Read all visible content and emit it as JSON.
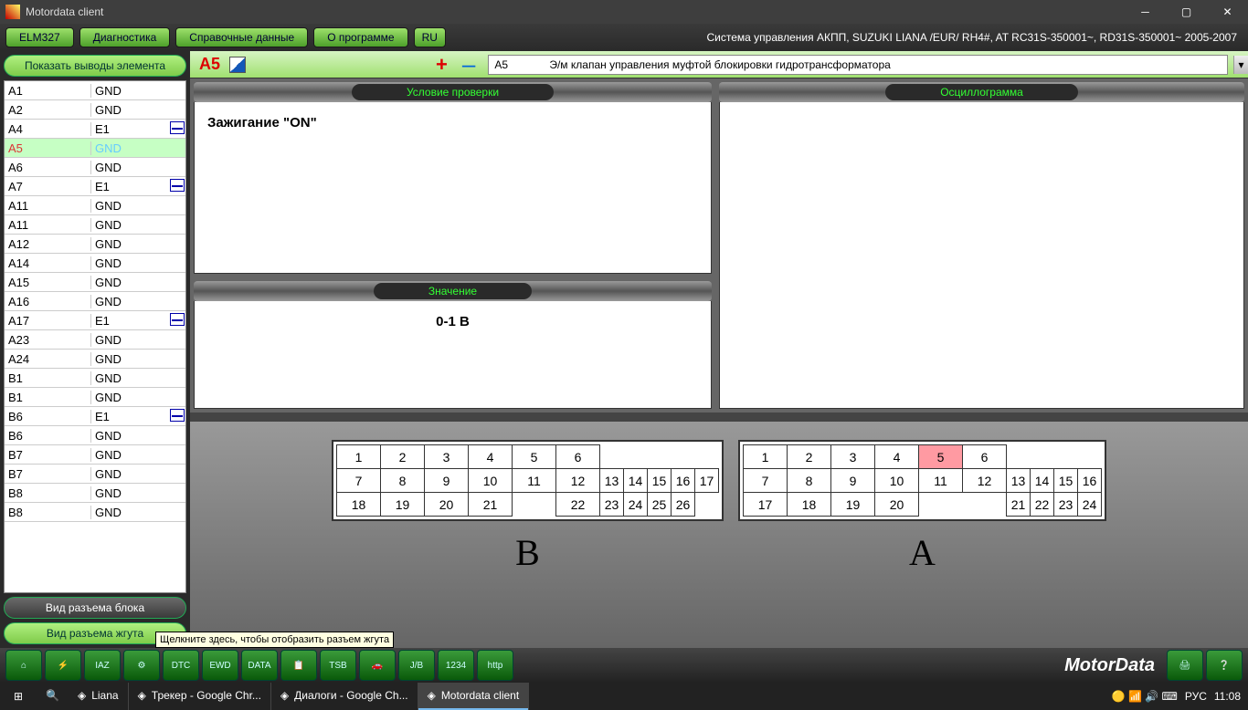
{
  "window": {
    "title": "Motordata client"
  },
  "topbar": {
    "btn1": "ELM327",
    "btn2": "Диагностика",
    "btn3": "Справочные данные",
    "btn4": "О программе",
    "lang": "RU",
    "info": "Система управления АКПП, SUZUKI  LIANA /EUR/  RH4#,   AT  RC31S-350001~, RD31S-350001~  2005-2007"
  },
  "sidebar": {
    "btn_show": "Показать выводы элемента",
    "btn_block": "Вид разъема блока",
    "btn_harness": "Вид разъема жгута",
    "pins": [
      {
        "p": "A1",
        "s": "GND"
      },
      {
        "p": "A2",
        "s": "GND"
      },
      {
        "p": "A4",
        "s": "E1",
        "w": true
      },
      {
        "p": "A5",
        "s": "GND",
        "sel": true
      },
      {
        "p": "A6",
        "s": "GND"
      },
      {
        "p": "A7",
        "s": "E1",
        "w": true
      },
      {
        "p": "A11",
        "s": "GND"
      },
      {
        "p": "A11",
        "s": "GND"
      },
      {
        "p": "A12",
        "s": "GND"
      },
      {
        "p": "A14",
        "s": "GND"
      },
      {
        "p": "A15",
        "s": "GND"
      },
      {
        "p": "A16",
        "s": "GND"
      },
      {
        "p": "A17",
        "s": "E1",
        "w": true
      },
      {
        "p": "A23",
        "s": "GND"
      },
      {
        "p": "A24",
        "s": "GND"
      },
      {
        "p": "B1",
        "s": "GND"
      },
      {
        "p": "B1",
        "s": "GND"
      },
      {
        "p": "B6",
        "s": "E1",
        "w": true
      },
      {
        "p": "B6",
        "s": "GND"
      },
      {
        "p": "B7",
        "s": "GND"
      },
      {
        "p": "B7",
        "s": "GND"
      },
      {
        "p": "B8",
        "s": "GND"
      },
      {
        "p": "B8",
        "s": "GND"
      }
    ]
  },
  "selection": {
    "pin": "A5",
    "code": "A5",
    "desc": "Э/м клапан управления муфтой блокировки гидротрансформатора"
  },
  "panels": {
    "cond_title": "Условие проверки",
    "cond_body": "Зажигание \"ON\"",
    "val_title": "Значение",
    "val_body": "0-1 В",
    "osc_title": "Осциллограмма"
  },
  "conn": {
    "B": {
      "r1": [
        "1",
        "2",
        "3",
        "4",
        "5",
        "6"
      ],
      "r2": [
        "7",
        "8",
        "9",
        "10",
        "11",
        "12",
        "13",
        "14",
        "15",
        "16",
        "17"
      ],
      "r3": [
        "18",
        "19",
        "20",
        "21",
        "",
        "22",
        "23",
        "24",
        "25",
        "26"
      ],
      "label": "B"
    },
    "A": {
      "r1": [
        "1",
        "2",
        "3",
        "4",
        "5",
        "6"
      ],
      "r2": [
        "7",
        "8",
        "9",
        "10",
        "11",
        "12",
        "13",
        "14",
        "15",
        "16"
      ],
      "r3": [
        "17",
        "18",
        "19",
        "20",
        "",
        "",
        "21",
        "22",
        "23",
        "24"
      ],
      "label": "A",
      "highlight": "5"
    }
  },
  "toolstrip": {
    "tooltip": "Щелкните здесь, чтобы отобразить разъем жгута",
    "btns": [
      "⌂",
      "⚡",
      "IAZ",
      "⚙",
      "DTC",
      "EWD",
      "DATA",
      "📋",
      "TSB",
      "🚗",
      "J/B",
      "1234",
      "http"
    ],
    "brand": "MotorData"
  },
  "taskbar": {
    "items": [
      {
        "t": "Liana"
      },
      {
        "t": "Трекер - Google Chr..."
      },
      {
        "t": "Диалоги - Google Ch..."
      },
      {
        "t": "Motordata client",
        "active": true
      }
    ],
    "lang": "РУС",
    "clock": "11:08"
  }
}
